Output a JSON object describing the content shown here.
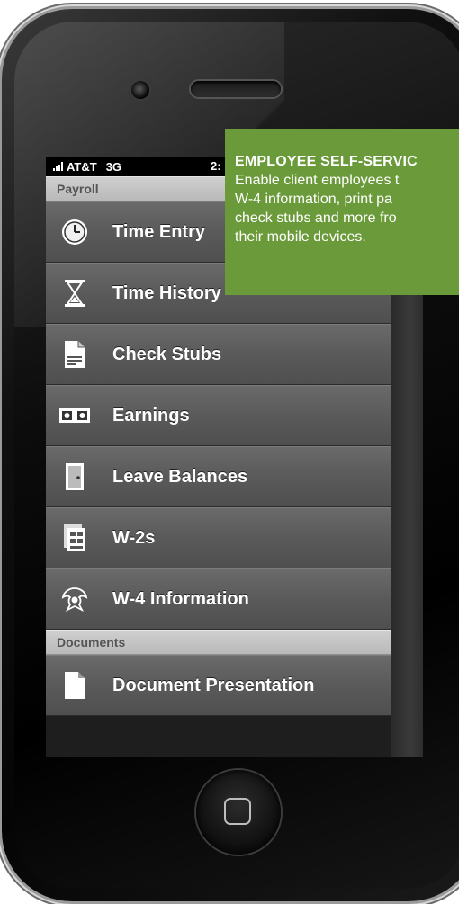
{
  "status_bar": {
    "carrier": "AT&T",
    "network": "3G",
    "time": "2:"
  },
  "sections": [
    {
      "header": "Payroll",
      "items": [
        {
          "label": "Time Entry",
          "icon": "clock-icon"
        },
        {
          "label": "Time History",
          "icon": "hourglass-icon"
        },
        {
          "label": "Check Stubs",
          "icon": "document-icon"
        },
        {
          "label": "Earnings",
          "icon": "money-icon"
        },
        {
          "label": "Leave Balances",
          "icon": "door-icon"
        },
        {
          "label": "W-2s",
          "icon": "forms-icon"
        },
        {
          "label": "W-4 Information",
          "icon": "eagle-seal-icon"
        }
      ]
    },
    {
      "header": "Documents",
      "items": [
        {
          "label": "Document Presentation",
          "icon": "page-icon"
        }
      ]
    }
  ],
  "callout": {
    "title": "EMPLOYEE SELF-SERVIC",
    "lines": [
      "Enable client employees t",
      "W-4 information, print pa",
      "check stubs and more fro",
      "their mobile devices."
    ],
    "color": "#6a9a3a"
  }
}
